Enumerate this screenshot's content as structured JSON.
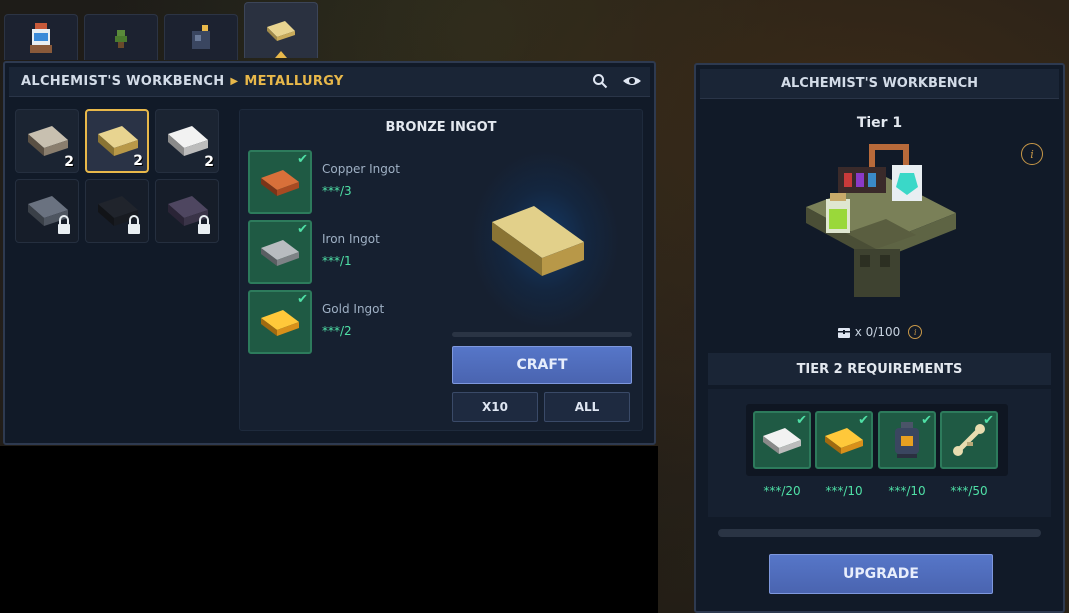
{
  "top_tabs": [
    {
      "icon": "potion-table-icon",
      "active": false
    },
    {
      "icon": "herb-icon",
      "active": false
    },
    {
      "icon": "bomb-icon",
      "active": false
    },
    {
      "icon": "ingot-icon",
      "active": true
    }
  ],
  "workbench": {
    "breadcrumb_root": "ALCHEMIST'S WORKBENCH",
    "breadcrumb_current": "METALLURGY",
    "search_icon": "search-icon",
    "view_icon": "eye-icon"
  },
  "inventory": [
    {
      "item": "iron-bronze-ingot",
      "count": "2",
      "locked": false,
      "selected": false
    },
    {
      "item": "gold-bronze-ingot",
      "count": "2",
      "locked": false,
      "selected": true
    },
    {
      "item": "silver-ingot",
      "count": "2",
      "locked": false,
      "selected": false
    },
    {
      "item": "locked-ingot-1",
      "count": "",
      "locked": true,
      "selected": false
    },
    {
      "item": "locked-ingot-2",
      "count": "",
      "locked": true,
      "selected": false
    },
    {
      "item": "locked-ingot-3",
      "count": "",
      "locked": true,
      "selected": false
    }
  ],
  "recipe": {
    "title": "BRONZE INGOT",
    "ingredients": [
      {
        "name": "Copper Ingot",
        "qty": "***/3",
        "color": "#c8602c"
      },
      {
        "name": "Iron Ingot",
        "qty": "***/1",
        "color": "#9ea2a6"
      },
      {
        "name": "Gold Ingot",
        "qty": "***/2",
        "color": "#e8a820"
      }
    ],
    "craft_label": "CRAFT",
    "x10_label": "X10",
    "all_label": "ALL"
  },
  "upgrade": {
    "header": "ALCHEMIST'S WORKBENCH",
    "tier_title": "Tier 1",
    "info_label": "i",
    "storage_text": "x 0/100",
    "storage_info": "i",
    "requirements_title": "TIER 2 REQUIREMENTS",
    "requirements": [
      {
        "item": "silver-ingot",
        "qty": "***/20"
      },
      {
        "item": "gold-ingot",
        "qty": "***/10"
      },
      {
        "item": "alchemy-flask",
        "qty": "***/10"
      },
      {
        "item": "bone-key",
        "qty": "***/50"
      }
    ],
    "upgrade_label": "UPGRADE"
  },
  "colors": {
    "accent_gold": "#e8b84a",
    "check_green": "#4fe0a6",
    "button_blue": "#4a64b0"
  }
}
